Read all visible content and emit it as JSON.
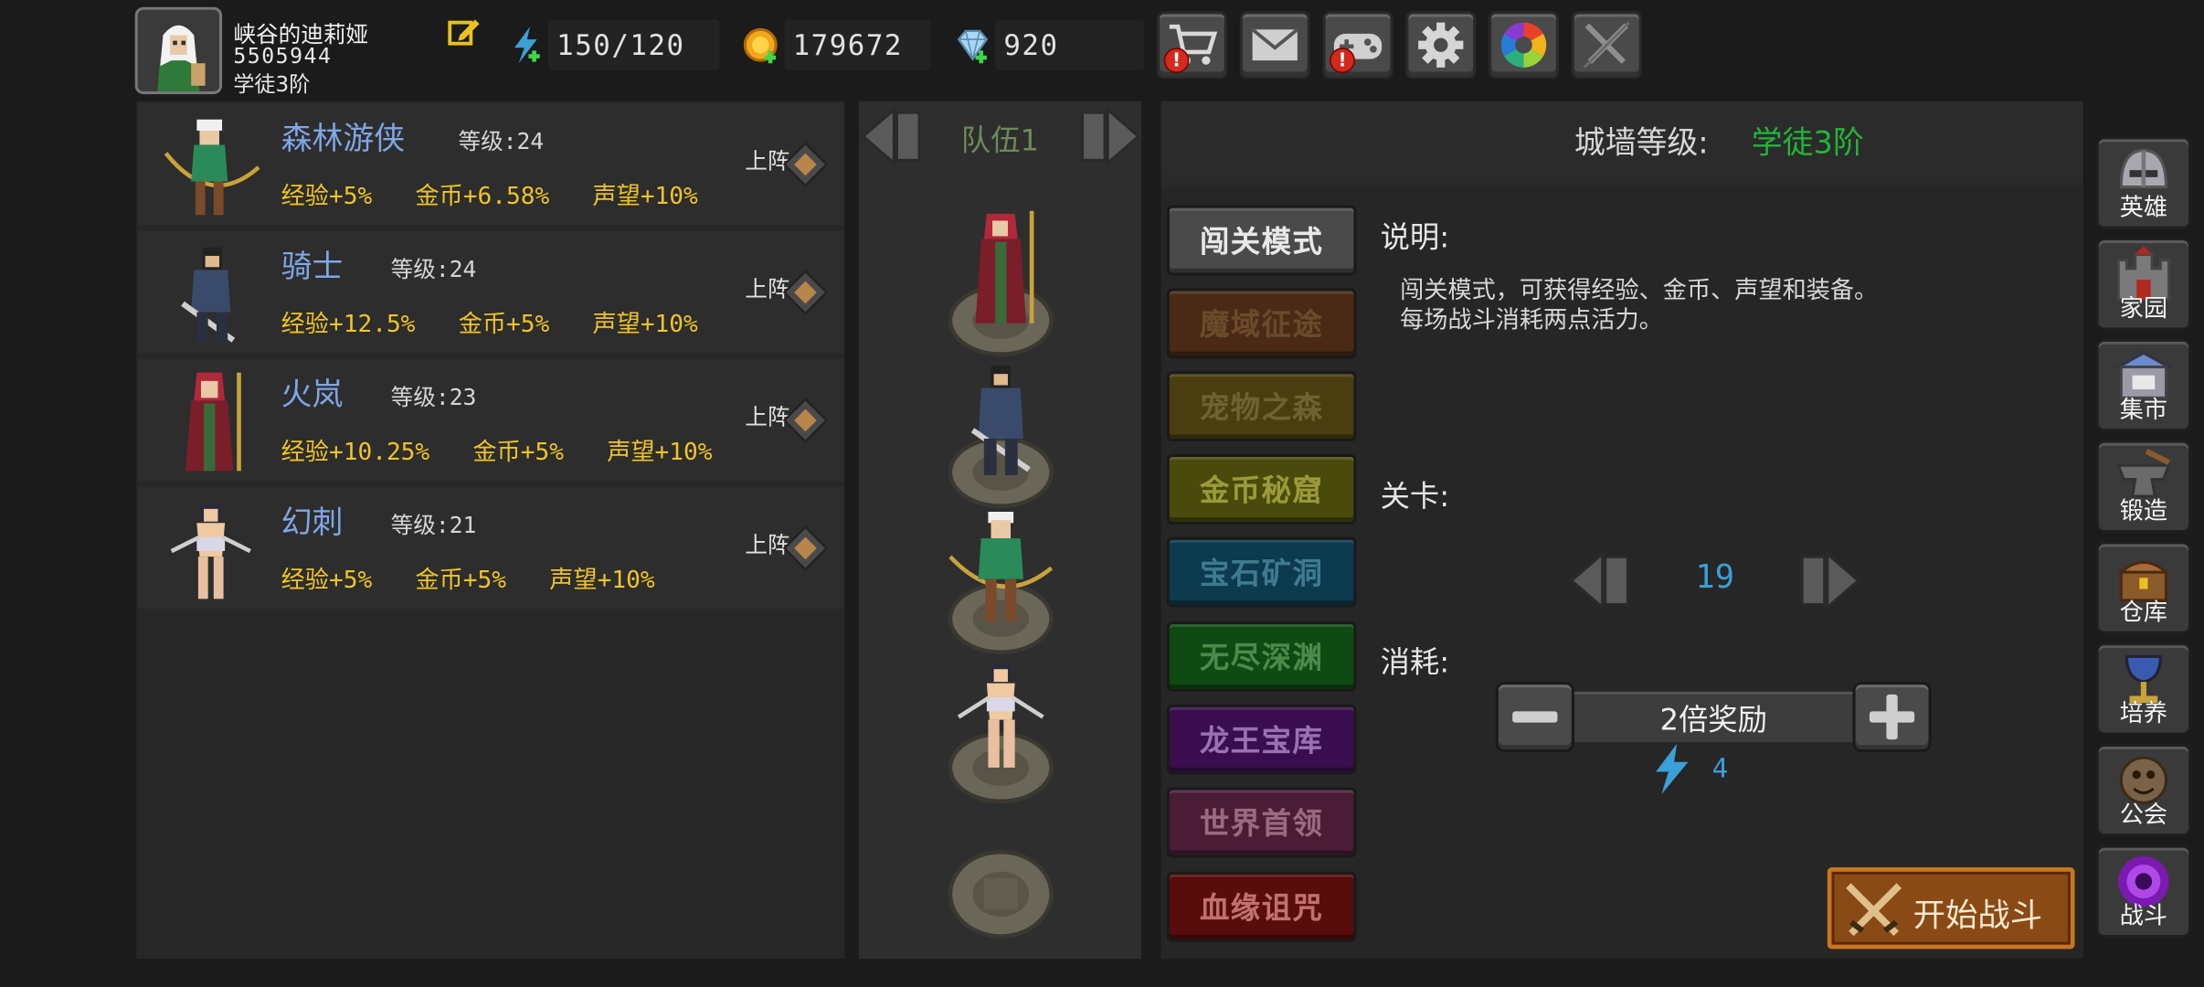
{
  "player": {
    "name": "峡谷的迪莉娅",
    "id": "5505944",
    "rank": "学徒3阶"
  },
  "resources": {
    "energy": "150/120",
    "gold": "179672",
    "gems": "920"
  },
  "toolbar": [
    {
      "icon": "shop-cart-icon",
      "badge": "!"
    },
    {
      "icon": "mail-icon",
      "badge": ""
    },
    {
      "icon": "gamepad-icon",
      "badge": "!"
    },
    {
      "icon": "gear-icon",
      "badge": ""
    },
    {
      "icon": "color-wheel-icon",
      "badge": ""
    },
    {
      "icon": "crossed-swords-icon",
      "badge": ""
    }
  ],
  "heroes": [
    {
      "name": "森林游侠",
      "level": "等级:24",
      "exp": "经验+5%",
      "gold": "金币+6.58%",
      "fame": "声望+10%",
      "deploy": "上阵"
    },
    {
      "name": "骑士",
      "level": "等级:24",
      "exp": "经验+12.5%",
      "gold": "金币+5%",
      "fame": "声望+10%",
      "deploy": "上阵"
    },
    {
      "name": "火岚",
      "level": "等级:23",
      "exp": "经验+10.25%",
      "gold": "金币+5%",
      "fame": "声望+10%",
      "deploy": "上阵"
    },
    {
      "name": "幻刺",
      "level": "等级:21",
      "exp": "经验+5%",
      "gold": "金币+5%",
      "fame": "声望+10%",
      "deploy": "上阵"
    }
  ],
  "team": {
    "label": "队伍1"
  },
  "wall": {
    "label": "城墙等级:",
    "value": "学徒3阶"
  },
  "modes": [
    {
      "label": "闯关模式",
      "color": "#4a4a4a",
      "text": "#e8e8e8"
    },
    {
      "label": "魔域征途",
      "color": "#4a2a14",
      "text": "#6b4a2c"
    },
    {
      "label": "宠物之森",
      "color": "#4a3e10",
      "text": "#6e6230"
    },
    {
      "label": "金币秘窟",
      "color": "#4a4a0c",
      "text": "#9a9a3a"
    },
    {
      "label": "宝石矿洞",
      "color": "#0c3a4e",
      "text": "#3e7a90"
    },
    {
      "label": "无尽深渊",
      "color": "#0e4a12",
      "text": "#4a8a4a"
    },
    {
      "label": "龙王宝库",
      "color": "#3a0e4e",
      "text": "#9a70b0"
    },
    {
      "label": "世界首领",
      "color": "#4a1c36",
      "text": "#9a6a80"
    },
    {
      "label": "血缘诅咒",
      "color": "#580c0c",
      "text": "#c07070"
    }
  ],
  "desc": {
    "label": "说明:",
    "line1": "闯关模式，可获得经验、金币、声望和装备。",
    "line2": "每场战斗消耗两点活力。"
  },
  "stage": {
    "label": "关卡:",
    "value": "19"
  },
  "cost": {
    "label": "消耗:",
    "reward": "2倍奖励",
    "energy": "4"
  },
  "start": {
    "label": "开始战斗"
  },
  "sidebar": [
    {
      "label": "英雄",
      "icon": "helmet-icon"
    },
    {
      "label": "家园",
      "icon": "castle-icon"
    },
    {
      "label": "集市",
      "icon": "market-icon"
    },
    {
      "label": "锻造",
      "icon": "anvil-icon"
    },
    {
      "label": "仓库",
      "icon": "chest-icon"
    },
    {
      "label": "培养",
      "icon": "chalice-icon"
    },
    {
      "label": "公会",
      "icon": "guild-icon"
    },
    {
      "label": "战斗",
      "icon": "portal-icon"
    }
  ],
  "colors": {
    "accent_green": "#23b43a",
    "hero_name": "#7fa6e6",
    "stat_yellow": "#f0c42a",
    "stage_blue": "#3b9fd8"
  }
}
